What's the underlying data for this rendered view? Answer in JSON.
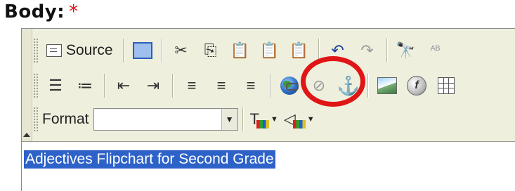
{
  "field": {
    "label": "Body:",
    "required_mark": "*"
  },
  "toolbar": {
    "row1": {
      "source_label": "Source",
      "icons": [
        "source-icon",
        "preview-icon",
        "cut-icon",
        "copy-icon",
        "paste-icon",
        "paste-text-icon",
        "paste-word-icon",
        "undo-icon",
        "redo-icon",
        "find-icon",
        "replace-icon"
      ]
    },
    "row2": {
      "icons": [
        "numbered-list-icon",
        "bulleted-list-icon",
        "outdent-icon",
        "indent-icon",
        "align-left-icon",
        "align-center-icon",
        "align-right-icon",
        "link-icon",
        "unlink-icon",
        "anchor-icon",
        "image-icon",
        "flash-icon",
        "table-icon"
      ]
    },
    "row3": {
      "format_label": "Format",
      "format_value": "",
      "text_color_glyph": "T",
      "bg_color_glyph": "◁"
    }
  },
  "editor": {
    "content_text": "Adjectives Flipchart for Second Grade"
  },
  "colors": {
    "highlight_ring": "#e01515",
    "selection": "#2d62c8",
    "toolbar_bg": "#efefde"
  }
}
